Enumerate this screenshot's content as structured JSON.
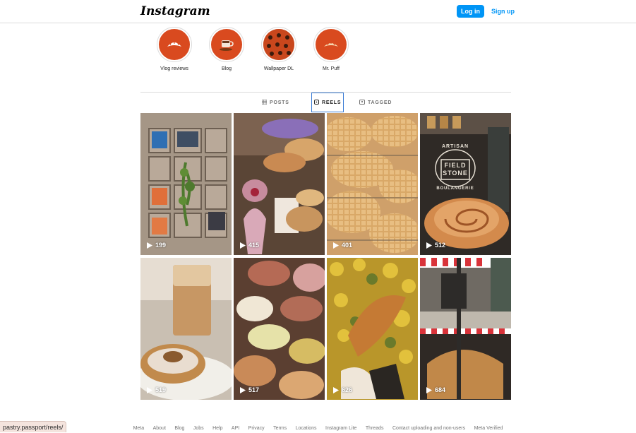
{
  "header": {
    "logo": "Instagram",
    "login_label": "Log in",
    "signup_label": "Sign up"
  },
  "highlights": [
    {
      "label": "Vlog reviews",
      "icon": "croissant-icon"
    },
    {
      "label": "Blog",
      "icon": "coffee-cup-icon"
    },
    {
      "label": "Wallpaper DL",
      "icon": "pattern-icon"
    },
    {
      "label": "Mr. Puff",
      "icon": "croissant-icon"
    }
  ],
  "tabs": [
    {
      "label": "POSTS",
      "icon": "grid-icon",
      "active": false
    },
    {
      "label": "REELS",
      "icon": "reels-icon",
      "active": true
    },
    {
      "label": "TAGGED",
      "icon": "tagged-icon",
      "active": false
    }
  ],
  "reels": [
    {
      "views": "199"
    },
    {
      "views": "415"
    },
    {
      "views": "401"
    },
    {
      "views": "512"
    },
    {
      "views": "519"
    },
    {
      "views": "517"
    },
    {
      "views": "626"
    },
    {
      "views": "684"
    }
  ],
  "reel_image_text": {
    "artisan": "ARTISAN",
    "field": "FIELD",
    "stone": "STONE",
    "boulangerie": "BOULANGERIE"
  },
  "footer": {
    "links": [
      "Meta",
      "About",
      "Blog",
      "Jobs",
      "Help",
      "API",
      "Privacy",
      "Terms",
      "Locations",
      "Instagram Lite",
      "Threads",
      "Contact uploading and non-users",
      "Meta Verified"
    ]
  },
  "status_url": "pastry.passport/reels/",
  "colors": {
    "accent": "#0095f6",
    "highlight_bg": "#d94a1f"
  }
}
